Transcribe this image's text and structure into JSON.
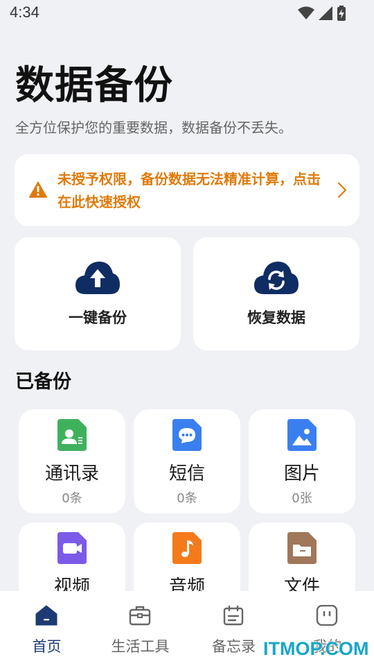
{
  "status_bar": {
    "time": "4:34",
    "icons": [
      "wifi-icon",
      "cell-signal-icon",
      "battery-charging-icon"
    ]
  },
  "header": {
    "title": "数据备份",
    "subtitle": "全方位保护您的重要数据，数据备份不丢失。"
  },
  "warning": {
    "icon": "warning-icon",
    "text": "未授予权限，备份数据无法精准计算，点击在此快速授权",
    "color": "#e07a0b"
  },
  "actions": [
    {
      "label": "一键备份",
      "icon": "cloud-upload-icon"
    },
    {
      "label": "恢复数据",
      "icon": "cloud-sync-icon"
    }
  ],
  "backed_up": {
    "title": "已备份",
    "items": [
      {
        "name": "通讯录",
        "count": "0条",
        "icon": "contacts-icon",
        "color": "#3fb15d"
      },
      {
        "name": "短信",
        "count": "0条",
        "icon": "sms-icon",
        "color": "#3a7ff0"
      },
      {
        "name": "图片",
        "count": "0张",
        "icon": "picture-icon",
        "color": "#3a7ff0"
      },
      {
        "name": "视频",
        "count": "",
        "icon": "video-icon",
        "color": "#7b5ae8"
      },
      {
        "name": "音频",
        "count": "",
        "icon": "audio-icon",
        "color": "#f57a1b"
      },
      {
        "name": "文件",
        "count": "",
        "icon": "file-icon",
        "color": "#a0775a"
      }
    ]
  },
  "bottom_nav": {
    "items": [
      {
        "label": "首页",
        "icon": "home-icon",
        "active": true
      },
      {
        "label": "生活工具",
        "icon": "toolbox-icon",
        "active": false
      },
      {
        "label": "备忘录",
        "icon": "calendar-icon",
        "active": false
      },
      {
        "label": "我的",
        "icon": "profile-icon",
        "active": false
      }
    ]
  },
  "colors": {
    "accent": "#1d3a73",
    "background": "#f0f1f5",
    "warning": "#e07a0b"
  },
  "watermark": "ITMOP.COM"
}
